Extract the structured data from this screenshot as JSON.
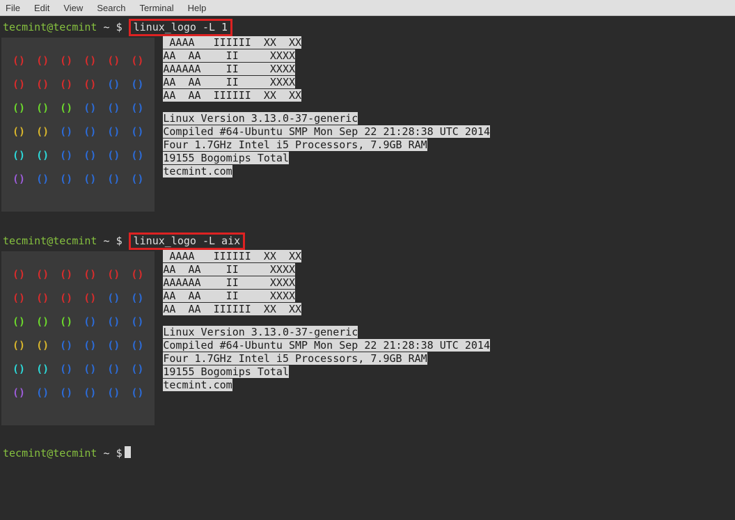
{
  "menubar": [
    "File",
    "Edit",
    "View",
    "Search",
    "Terminal",
    "Help"
  ],
  "prompt": {
    "user": "tecmint",
    "host": "tecmint",
    "cwd": "~",
    "symbol": "$"
  },
  "commands": {
    "cmd1": "linux_logo -L 1",
    "cmd2": "linux_logo -L aix"
  },
  "ascii_logo": {
    "l1": " AAAA   IIIIII  XX  XX",
    "l2": "AA  AA    II     XXXX",
    "l3": "AAAAAA    II     XXXX",
    "l4": "AA  AA    II     XXXX",
    "l5": "AA  AA  IIIIII  XX  XX"
  },
  "sysinfo": {
    "version": "Linux Version 3.13.0-37-generic",
    "compiled": "Compiled #64-Ubuntu SMP Mon Sep 22 21:28:38 UTC 2014",
    "cpu": "Four 1.7GHz Intel i5 Processors, 7.9GB RAM",
    "bogo": "19155 Bogomips Total",
    "site": "tecmint.com"
  },
  "palette": [
    [
      "c0",
      "c0",
      "c0",
      "c0",
      "c0",
      "c0"
    ],
    [
      "c0",
      "c0",
      "c0",
      "c0",
      "c1",
      "c1"
    ],
    [
      "c2",
      "c2",
      "c2",
      "c1",
      "c1",
      "c1"
    ],
    [
      "c3",
      "c3",
      "c1",
      "c1",
      "c1",
      "c1"
    ],
    [
      "c4",
      "c4",
      "c1",
      "c1",
      "c1",
      "c1"
    ],
    [
      "c5",
      "c1",
      "c1",
      "c1",
      "c1",
      "c1"
    ]
  ]
}
